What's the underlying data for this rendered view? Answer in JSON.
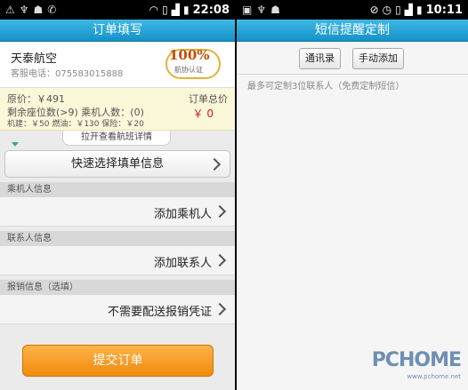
{
  "left": {
    "status": {
      "time": "22:08"
    },
    "title": "订单填写",
    "airline": {
      "name": "天泰航空",
      "phone": "客服电话：075583015888"
    },
    "badge": {
      "percent": "100%",
      "caption": "航协认证"
    },
    "price": {
      "original": "原价：￥491",
      "seats": "剩余座位数(>9) 乘机人数：(0)",
      "fees": "机建：￥50  燃油：￥130  保险：￥20",
      "total_label": "订单总价",
      "total_value": "￥ 0"
    },
    "pull_tab": "拉开查看航班详情",
    "quick_select": "快速选择填单信息",
    "sections": [
      {
        "header": "乘机人信息",
        "row": "添加乘机人"
      },
      {
        "header": "联系人信息",
        "row": "添加联系人"
      },
      {
        "header": "报销信息（选填）",
        "row": "不需要配送报销凭证"
      }
    ],
    "submit": "提交订单"
  },
  "right": {
    "status": {
      "time": "10:11"
    },
    "title": "短信提醒定制",
    "buttons": {
      "contacts": "通讯录",
      "manual": "手动添加"
    },
    "hint": "最多可定制3位联系人（免费定制短信）"
  },
  "watermark": {
    "brand": "PCHOME",
    "url": "www.pchome.net"
  },
  "colors": {
    "titlebar": "#1492c8",
    "submit": "#f08a0c",
    "price_total": "#d61b1b"
  }
}
